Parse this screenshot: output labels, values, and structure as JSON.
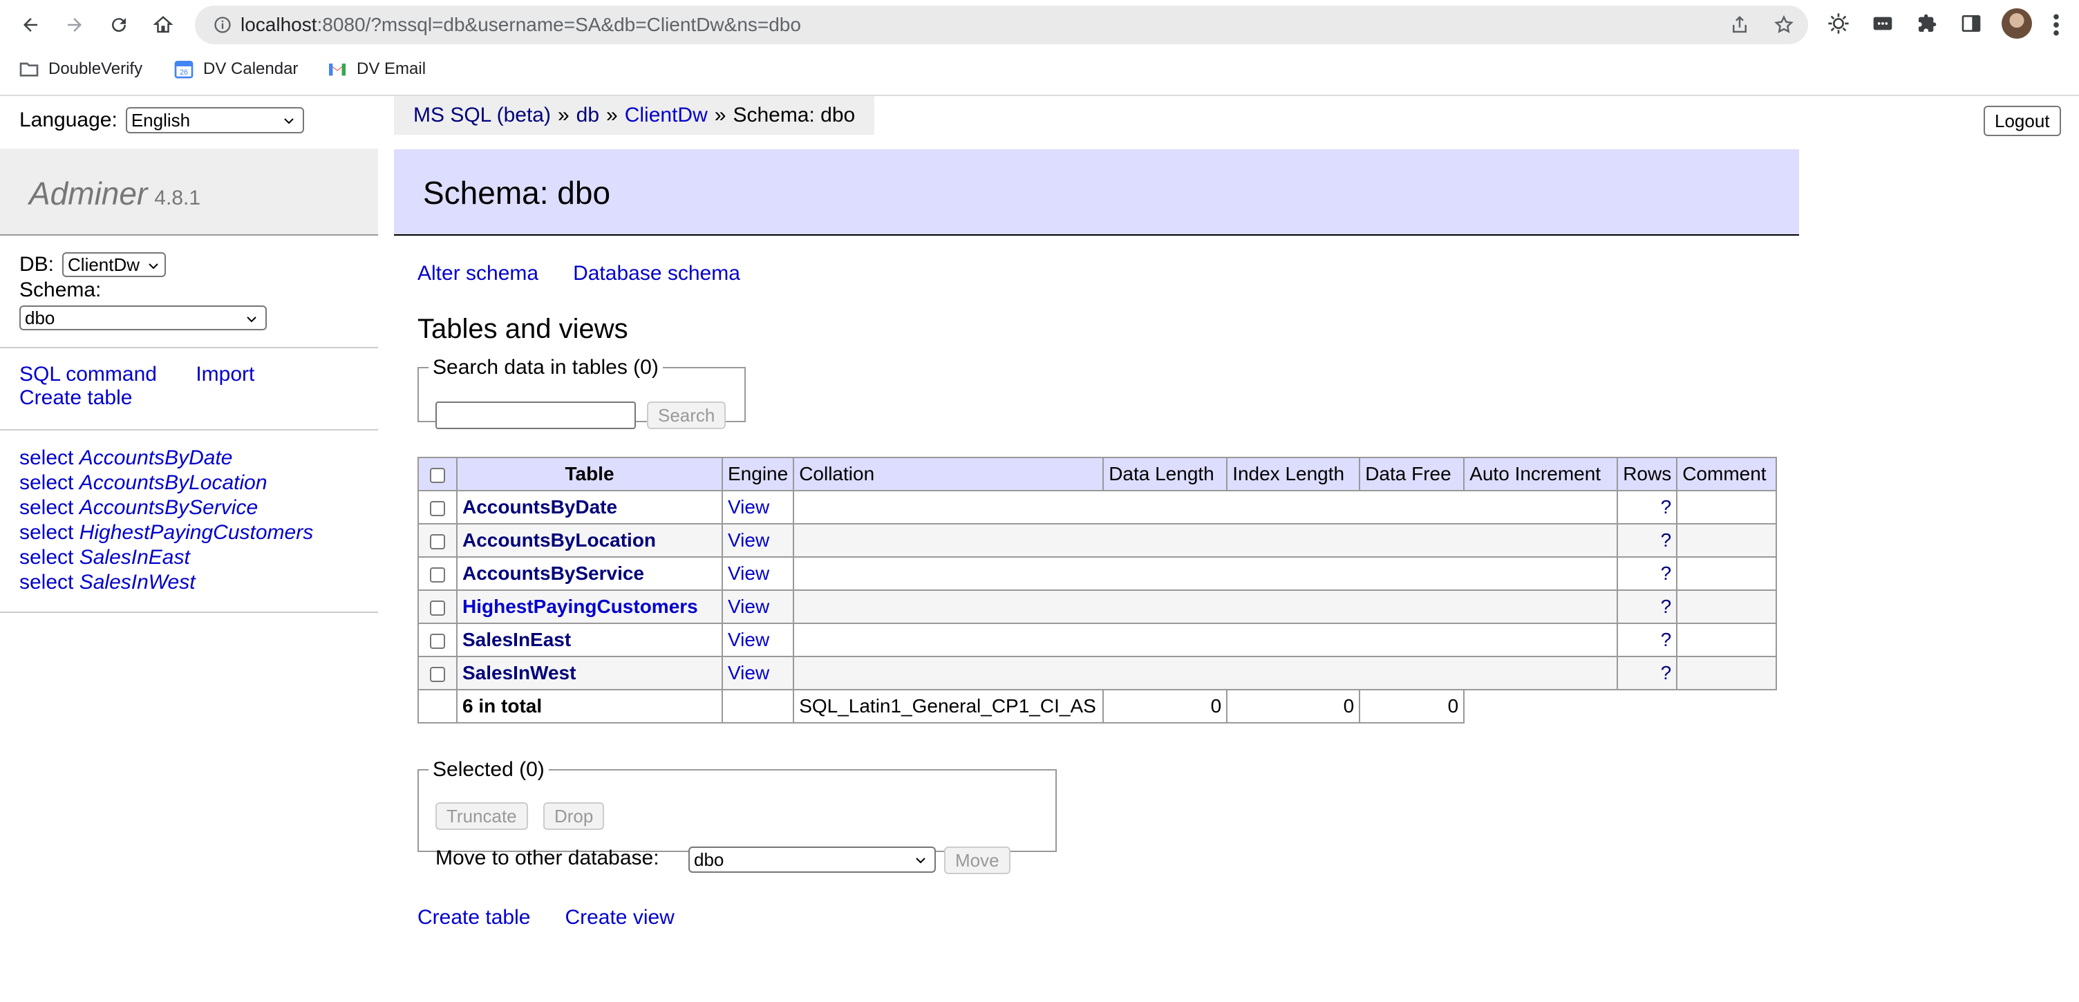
{
  "browser": {
    "url_host": "localhost",
    "url_rest": ":8080/?mssql=db&username=SA&db=ClientDw&ns=dbo",
    "bookmarks": [
      {
        "label": "DoubleVerify",
        "icon": "folder-icon"
      },
      {
        "label": "DV Calendar",
        "icon": "calendar-icon"
      },
      {
        "label": "DV Email",
        "icon": "gmail-icon"
      }
    ]
  },
  "sidebar": {
    "language_label": "Language:",
    "language_value": "English",
    "app_name": "Adminer",
    "app_version": "4.8.1",
    "db_label": "DB:",
    "db_value": "ClientDw",
    "schema_label": "Schema:",
    "schema_value": "dbo",
    "sql_command": "SQL command",
    "import": "Import",
    "create_table": "Create table",
    "select_prefix": "select",
    "tables": [
      "AccountsByDate",
      "AccountsByLocation",
      "AccountsByService",
      "HighestPayingCustomers",
      "SalesInEast",
      "SalesInWest"
    ]
  },
  "header": {
    "breadcrumb": [
      "MS SQL (beta)",
      "db",
      "ClientDw",
      "Schema: dbo"
    ],
    "separator": "»",
    "logout": "Logout",
    "title": "Schema: dbo"
  },
  "main": {
    "alter_schema": "Alter schema",
    "database_schema": "Database schema",
    "section_title": "Tables and views",
    "search_legend": "Search data in tables (0)",
    "search_button": "Search",
    "table": {
      "columns": [
        "Table",
        "Engine",
        "Collation",
        "Data Length",
        "Index Length",
        "Data Free",
        "Auto Increment",
        "Rows",
        "Comment"
      ],
      "rows": [
        {
          "name": "AccountsByDate",
          "engine": "View",
          "rows": "?"
        },
        {
          "name": "AccountsByLocation",
          "engine": "View",
          "rows": "?"
        },
        {
          "name": "AccountsByService",
          "engine": "View",
          "rows": "?"
        },
        {
          "name": "HighestPayingCustomers",
          "engine": "View",
          "rows": "?"
        },
        {
          "name": "SalesInEast",
          "engine": "View",
          "rows": "?"
        },
        {
          "name": "SalesInWest",
          "engine": "View",
          "rows": "?"
        }
      ],
      "total": {
        "label": "6 in total",
        "collation": "SQL_Latin1_General_CP1_CI_AS",
        "data_length": "0",
        "index_length": "0",
        "data_free": "0"
      }
    },
    "selected_legend": "Selected (0)",
    "truncate": "Truncate",
    "drop": "Drop",
    "move_label": "Move to other database:",
    "move_value": "dbo",
    "move_button": "Move",
    "create_table": "Create table",
    "create_view": "Create view"
  },
  "colors": {
    "link": "#0000cc",
    "header_bg": "#ddf",
    "sidebar_bg": "#eee"
  }
}
